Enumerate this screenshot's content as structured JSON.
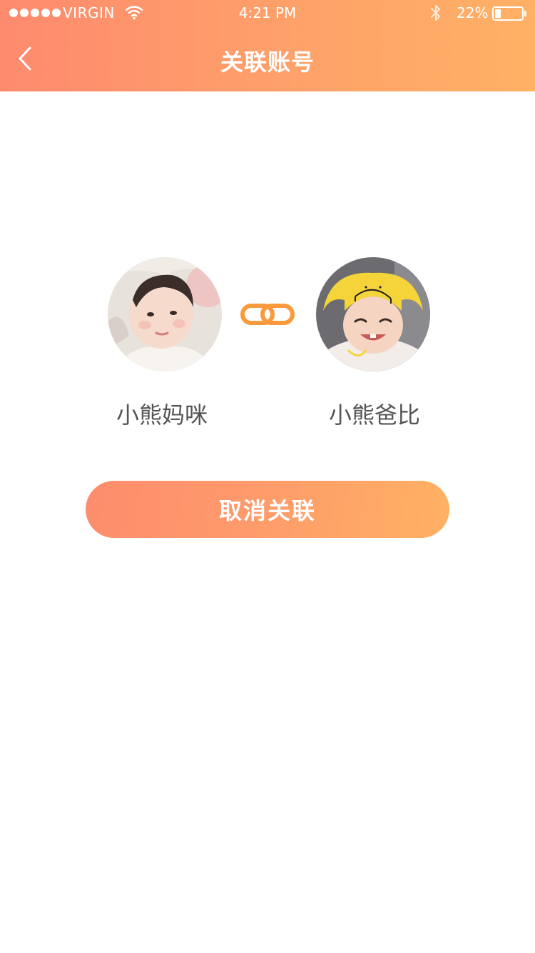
{
  "status_bar": {
    "carrier": "VIRGIN",
    "time": "4:21 PM",
    "battery_percent": "22%",
    "battery_level": 0.22,
    "signal_dots": 5,
    "icons": [
      "wifi-icon",
      "bluetooth-icon",
      "battery-icon"
    ]
  },
  "nav": {
    "title": "关联账号",
    "back_icon": "chevron-left-icon"
  },
  "accounts": {
    "left": {
      "name": "小熊妈咪"
    },
    "right": {
      "name": "小熊爸比"
    },
    "link_icon": "chain-link-icon"
  },
  "actions": {
    "unlink_label": "取消关联"
  },
  "colors": {
    "header_gradient_start": "#fe8a6e",
    "header_gradient_end": "#ffb165",
    "link_icon": "#fa9a3c",
    "name_text": "#555555",
    "button_gradient_start": "#fd8d6d",
    "button_gradient_end": "#ffb163"
  }
}
